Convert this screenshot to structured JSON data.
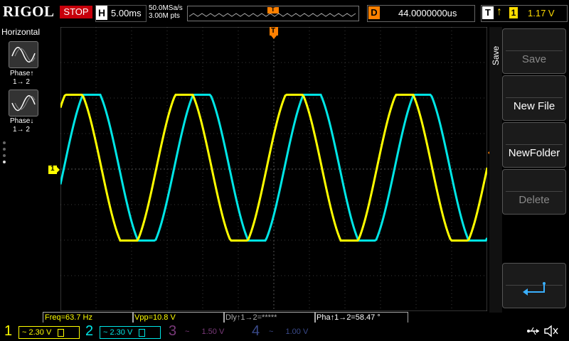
{
  "topbar": {
    "logo": "RIGOL",
    "run_state": "STOP",
    "timebase_badge": "H",
    "timebase": "5.00ms",
    "sample_rate": "50.0MSa/s",
    "memory_depth": "3.00M pts",
    "trigger_marker": "T",
    "delay_badge": "D",
    "delay_value": "44.0000000us",
    "trigger_badge": "T",
    "trigger_edge": "↑",
    "trigger_source": "1",
    "trigger_level": "1.17 V"
  },
  "left_panel": {
    "title": "Horizontal",
    "items": [
      {
        "label_line1": "Phase↑",
        "label_line2": "1→ 2",
        "icon": "sine-wave-icon"
      },
      {
        "label_line1": "Phase↓",
        "label_line2": "1→ 2",
        "icon": "sine-wave-icon"
      }
    ]
  },
  "screen": {
    "trigger_pos_marker": "T",
    "ch1_marker": "1",
    "trigger_level_marker": "T"
  },
  "right_menu": {
    "title": "Save",
    "buttons": [
      {
        "label": "Save",
        "enabled": false
      },
      {
        "label": "New File",
        "enabled": true
      },
      {
        "label": "NewFolder",
        "enabled": true
      },
      {
        "label": "Delete",
        "enabled": false
      },
      {
        "label": "",
        "icon": "return-arrow-icon",
        "enabled": true
      }
    ]
  },
  "measurements": {
    "freq": "Freq=63.7 Hz",
    "vpp": "Vpp=10.8 V",
    "delay": "Dly↑1→2=*****",
    "phase": "Pha↑1→2=58.47 °"
  },
  "channels": [
    {
      "num": "1",
      "coupling": "~",
      "scale": "2.30 V",
      "color": "#ffff00",
      "active": true
    },
    {
      "num": "2",
      "coupling": "~",
      "scale": "2.30 V",
      "color": "#00e6e6",
      "active": true
    },
    {
      "num": "3",
      "coupling": "~",
      "scale": "1.50 V",
      "color": "#c040c0",
      "active": false
    },
    {
      "num": "4",
      "coupling": "~",
      "scale": "1.00 V",
      "color": "#3060ff",
      "active": false
    }
  ],
  "colors": {
    "ch1": "#ffff00",
    "ch2": "#00e6e6",
    "trigger": "#ff8000",
    "stop": "#c7000b"
  },
  "status_icons": [
    "usb-icon",
    "speaker-mute-icon"
  ]
}
